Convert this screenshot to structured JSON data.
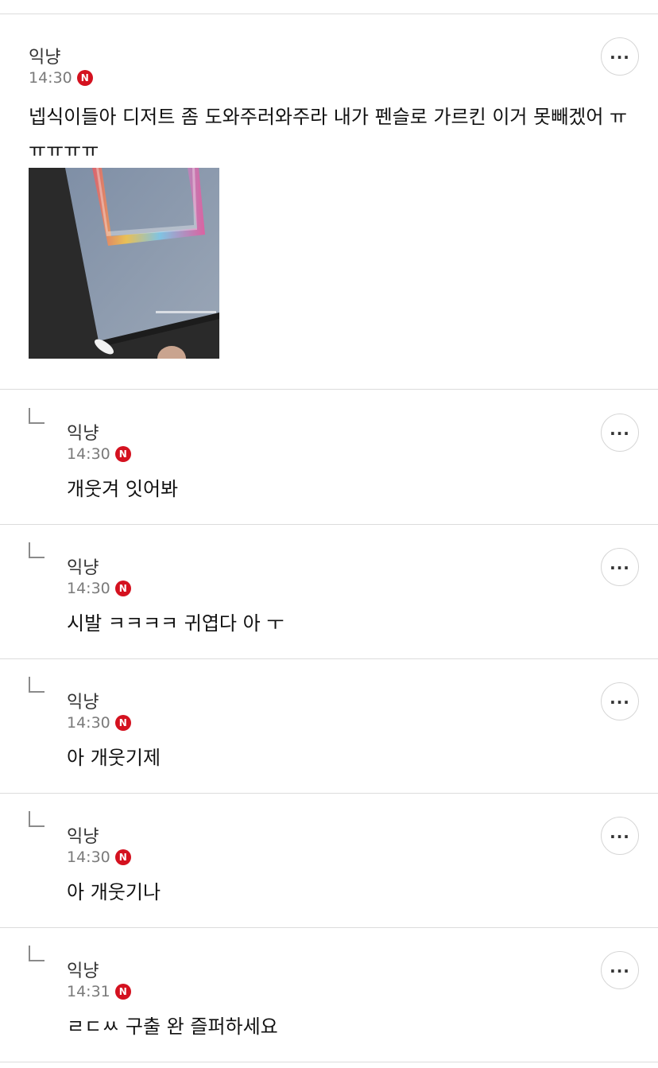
{
  "post": {
    "author": "익냥",
    "time": "14:30",
    "badge": "N",
    "text": "넵식이들아 디저트 좀 도와주러와주라 내가 펜슬로 가르킨 이거 못빼겠어 ㅠㅠㅠㅠㅠ",
    "image_icon": "photo-thumbnail"
  },
  "more_icon": "more-horizontal-icon",
  "reply_icon": "reply-arrow-icon",
  "accent_color": "#d4111f",
  "comments": [
    {
      "author": "익냥",
      "time": "14:30",
      "badge": "N",
      "text": "개웃겨 잇어봐"
    },
    {
      "author": "익냥",
      "time": "14:30",
      "badge": "N",
      "text": "시발 ㅋㅋㅋㅋ 귀엽다 아 ㅜ"
    },
    {
      "author": "익냥",
      "time": "14:30",
      "badge": "N",
      "text": "아 개웃기제"
    },
    {
      "author": "익냥",
      "time": "14:30",
      "badge": "N",
      "text": "아 개웃기나"
    },
    {
      "author": "익냥",
      "time": "14:31",
      "badge": "N",
      "text": "ㄹㄷㅆ 구출 완 즐퍼하세요"
    }
  ]
}
